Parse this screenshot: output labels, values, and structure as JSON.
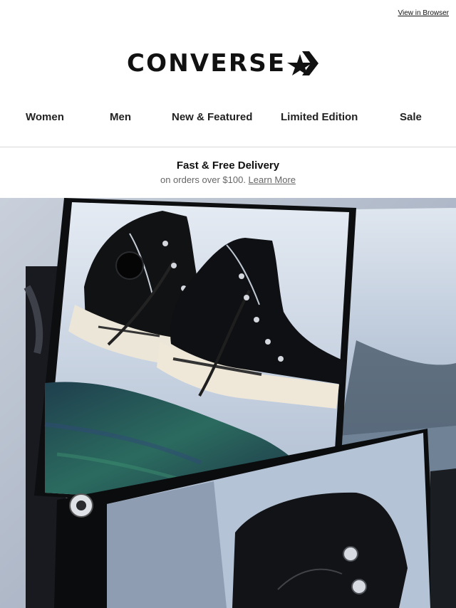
{
  "header": {
    "view_in_browser": "View in Browser",
    "logo_text": "CONVERSE"
  },
  "nav": {
    "items": [
      {
        "label": "Women"
      },
      {
        "label": "Men"
      },
      {
        "label": "New & Featured"
      },
      {
        "label": "Limited Edition"
      },
      {
        "label": "Sale"
      }
    ]
  },
  "promo": {
    "title": "Fast & Free Delivery",
    "subtitle_prefix": "on orders over $100. ",
    "learn_more": "Learn More"
  },
  "hero": {
    "icon": "sneaker-hero-image",
    "colors": {
      "sky": "#aeb7c4",
      "shoe": "#111214",
      "sole": "#ece6d8",
      "tartan": "#294e4c"
    }
  }
}
